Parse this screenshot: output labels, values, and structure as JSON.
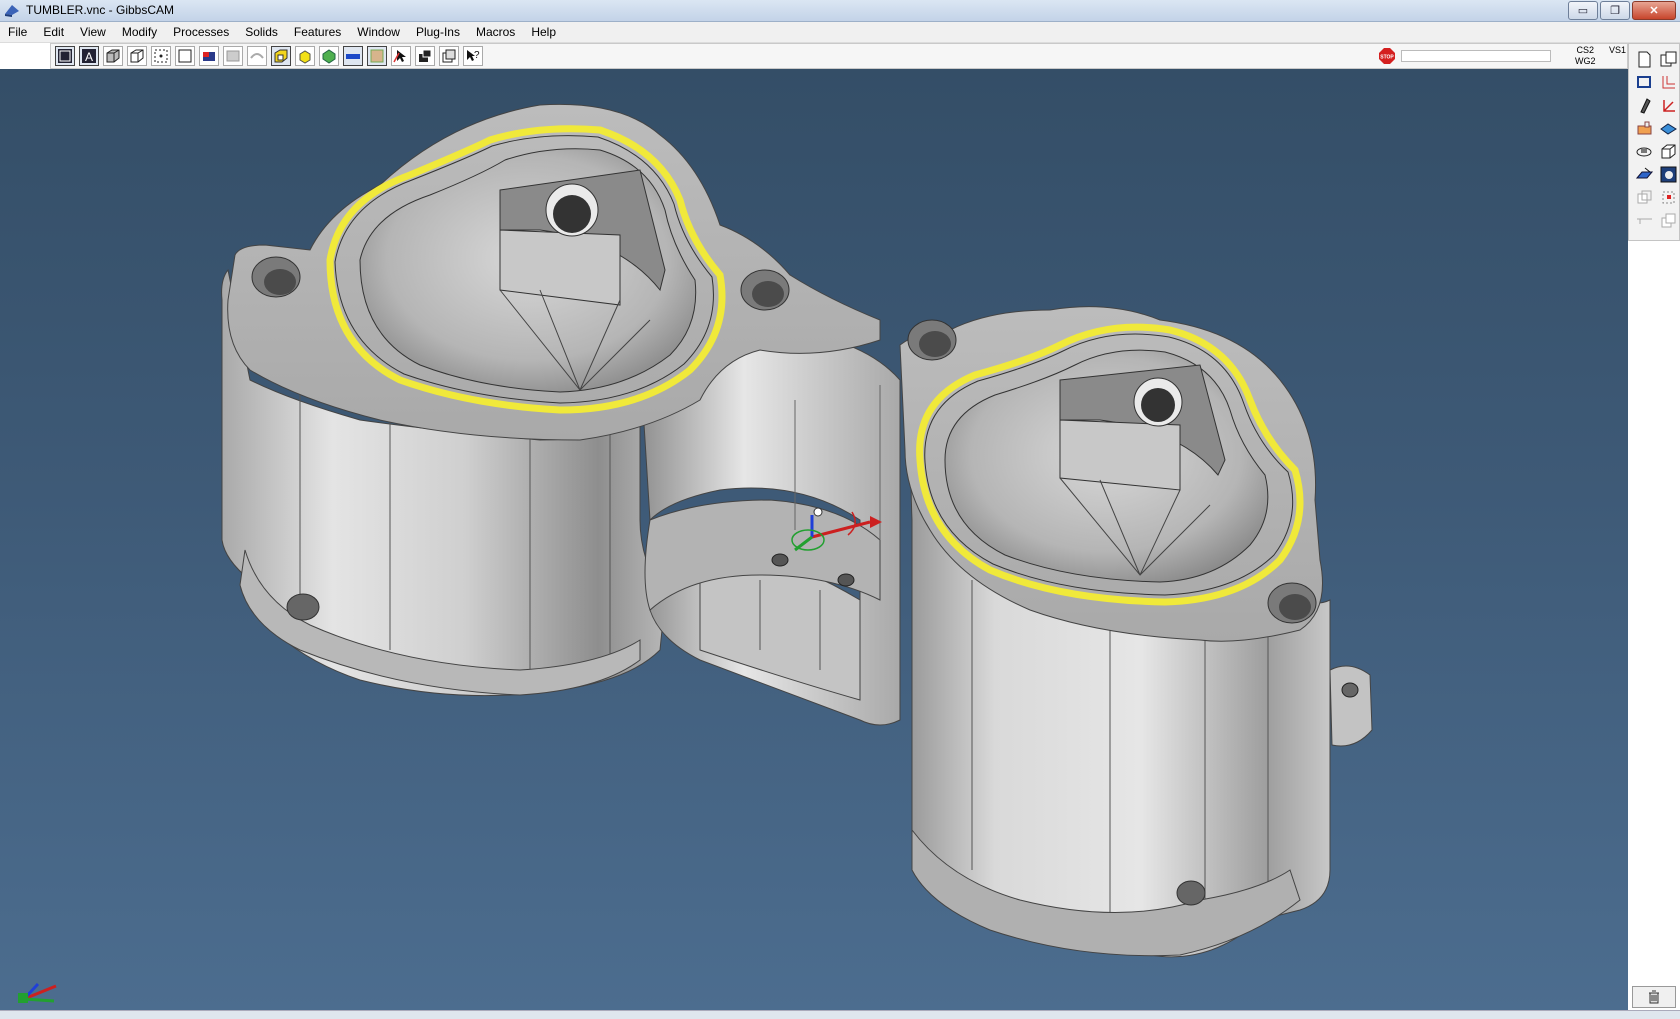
{
  "window": {
    "title": "TUMBLER.vnc - GibbsCAM",
    "minimize_symbol": "▭",
    "restore_symbol": "❐",
    "close_symbol": "✕"
  },
  "menu": [
    "File",
    "Edit",
    "View",
    "Modify",
    "Processes",
    "Solids",
    "Features",
    "Window",
    "Plug-Ins",
    "Macros",
    "Help"
  ],
  "toolbar": {
    "icons": [
      "wireframe-view-icon",
      "text-tool-icon",
      "shaded-box-icon",
      "hidden-line-box-icon",
      "point-select-icon",
      "rectangle-icon",
      "red-cap-icon",
      "disabled-shape-icon",
      "disabled-arc-icon",
      "yellow-box-icon",
      "yellow-cube-icon",
      "green-solid-icon",
      "toolpath-blue-icon",
      "beige-solid-icon",
      "select-arrow-icon",
      "stack-icon",
      "copy-icon",
      "help-cursor-icon"
    ],
    "stop_label": "STOP",
    "progress_value": 0,
    "status_cs": "CS2",
    "status_wg": "WG2",
    "status_vs": "VS1"
  },
  "palette": {
    "icons": [
      "new-document-icon",
      "windows-icon",
      "rectangle-select-icon",
      "axis-pair-icon",
      "pen-icon",
      "axis-red-icon",
      "orange-tool-icon",
      "blue-plane-icon",
      "rotate-view-icon",
      "box-outline-icon",
      "blue-parallelogram-icon",
      "render-icon",
      "grey-copy-icon",
      "red-select-icon",
      "grey-line-icon",
      "grey-stack-icon"
    ]
  },
  "viewport": {
    "background_top": "#344e67",
    "background_bottom": "#4c6d8f",
    "part_face_color": "#c9c9c9",
    "part_shadow_color": "#8f8f8f",
    "highlight_color": "#f0e93a",
    "axis_x_color": "#cc2020",
    "axis_y_color": "#22a030",
    "axis_z_color": "#1f3fd8"
  }
}
